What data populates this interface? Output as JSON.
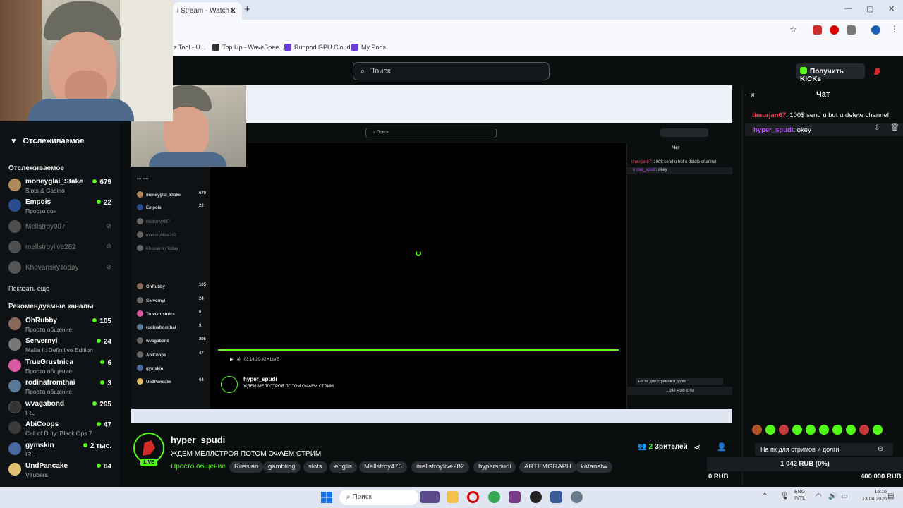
{
  "browser": {
    "tab_title": "i Stream - Watch L",
    "new_tab": "+",
    "bookmarks": [
      {
        "label": "s Tool - U..."
      },
      {
        "label": "Top Up - WaveSpee..."
      },
      {
        "label": "Runpod GPU Cloud"
      },
      {
        "label": "My Pods"
      }
    ]
  },
  "header": {
    "search_placeholder": "Поиск",
    "get_kicks": "Получить KICKs"
  },
  "sidebar": {
    "followed_nav": "Отслеживаемое",
    "followed_title": "Отслеживаемое",
    "followed": [
      {
        "name": "moneyglai_Stake",
        "sub": "Slots & Casino",
        "viewers": "679",
        "avatar": "#b08a5a"
      },
      {
        "name": "Empois",
        "sub": "Просто сон",
        "viewers": "22",
        "avatar": "#2a4d8f"
      },
      {
        "name": "Mellstroy987",
        "sub": "",
        "viewers": "",
        "avatar": "#999"
      },
      {
        "name": "mellstroylive282",
        "sub": "",
        "viewers": "",
        "avatar": "#999"
      },
      {
        "name": "KhovanskyToday",
        "sub": "",
        "viewers": "",
        "avatar": "#aaa"
      }
    ],
    "show_more": "Показать еще",
    "recommended_title": "Рекомендуемые каналы",
    "recommended": [
      {
        "name": "OhRubby",
        "sub": "Просто общение",
        "viewers": "105",
        "avatar": "#8a6a5a"
      },
      {
        "name": "Servernyi",
        "sub": "Mafia II: Definitive Edition",
        "viewers": "24",
        "avatar": "#777"
      },
      {
        "name": "TrueGrustnica",
        "sub": "Просто общение",
        "viewers": "6",
        "avatar": "#d85aa0"
      },
      {
        "name": "rodinafromthai",
        "sub": "Просто общение",
        "viewers": "3",
        "avatar": "#5a7a9a"
      },
      {
        "name": "wvagabond",
        "sub": "IRL",
        "viewers": "295",
        "avatar": "#333"
      },
      {
        "name": "AbiCoops",
        "sub": "Call of Duty: Black Ops 7",
        "viewers": "47",
        "avatar": "#3a3a3a"
      },
      {
        "name": "gymskin",
        "sub": "IRL",
        "viewers": "2 тыс.",
        "avatar": "#4a6aa0"
      },
      {
        "name": "UndPancake",
        "sub": "VTubers",
        "viewers": "64",
        "avatar": "#e0c070"
      }
    ]
  },
  "inner": {
    "search": "Поиск",
    "chat_title": "Чат",
    "time": "03:14:20:42",
    "live": "LIVE",
    "name": "hyper_spudi",
    "title": "ЖДЕМ МЕЛЛСТРОЯ ПОТОМ ОФАЕМ СТРИМ",
    "goal": "На пк для стримов и долги",
    "goal_amt": "1 042 RUB (0%)"
  },
  "stream": {
    "name": "hyper_spudi",
    "title": "ЖДЕМ МЕЛЛСТРОЯ ПОТОМ ОФАЕМ СТРИМ",
    "category": "Просто общение",
    "live": "LIVE",
    "tags": [
      "Russian",
      "gambling",
      "slots",
      "englis",
      "Mellstroy475",
      "mellstroylive282",
      "hyperspudi",
      "ARTEMGRAPH",
      "katanatw"
    ],
    "viewers_count": "2",
    "viewers_label": "Зрителей"
  },
  "chat": {
    "title": "Чат",
    "messages": [
      {
        "user": "timurjan67",
        "text": ": 100$ send u but u delete channel"
      },
      {
        "user": "hyper_spudi",
        "text": ": okey"
      }
    ],
    "goal_text": "На пк для стримов и долги",
    "goal_amount": "1 042 RUB (0%)",
    "rub_left": "0 RUB",
    "rub_right": "400 000 RUB"
  },
  "taskbar": {
    "search": "Поиск",
    "lang1": "ENG",
    "lang2": "INTL",
    "time": "16:16",
    "date": "13.04.2026"
  }
}
